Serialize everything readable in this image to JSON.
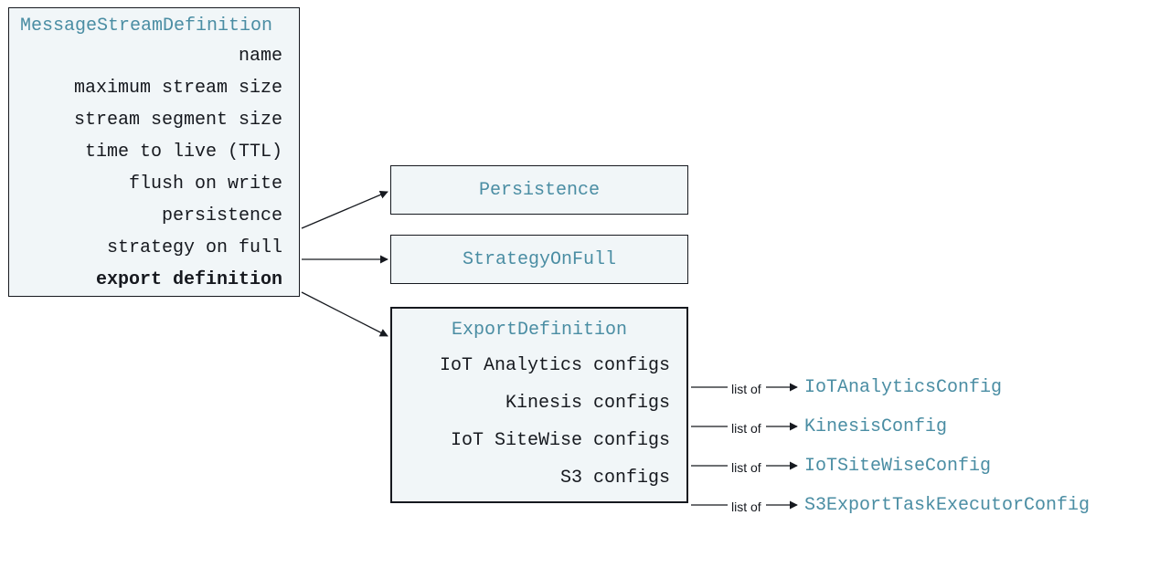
{
  "msd": {
    "title": "MessageStreamDefinition",
    "items": [
      "name",
      "maximum stream size",
      "stream segment size",
      "time to live (TTL)",
      "flush on write",
      "persistence",
      "strategy on full",
      "export definition"
    ]
  },
  "persistence": {
    "title": "Persistence"
  },
  "strategyOnFull": {
    "title": "StrategyOnFull"
  },
  "exportDef": {
    "title": "ExportDefinition",
    "items": [
      "IoT Analytics configs",
      "Kinesis configs",
      "IoT SiteWise configs",
      "S3 configs"
    ]
  },
  "listOf": "list of",
  "types": {
    "iotAnalytics": "IoTAnalyticsConfig",
    "kinesis": "KinesisConfig",
    "iotSiteWise": "IoTSiteWiseConfig",
    "s3": "S3ExportTaskExecutorConfig"
  }
}
